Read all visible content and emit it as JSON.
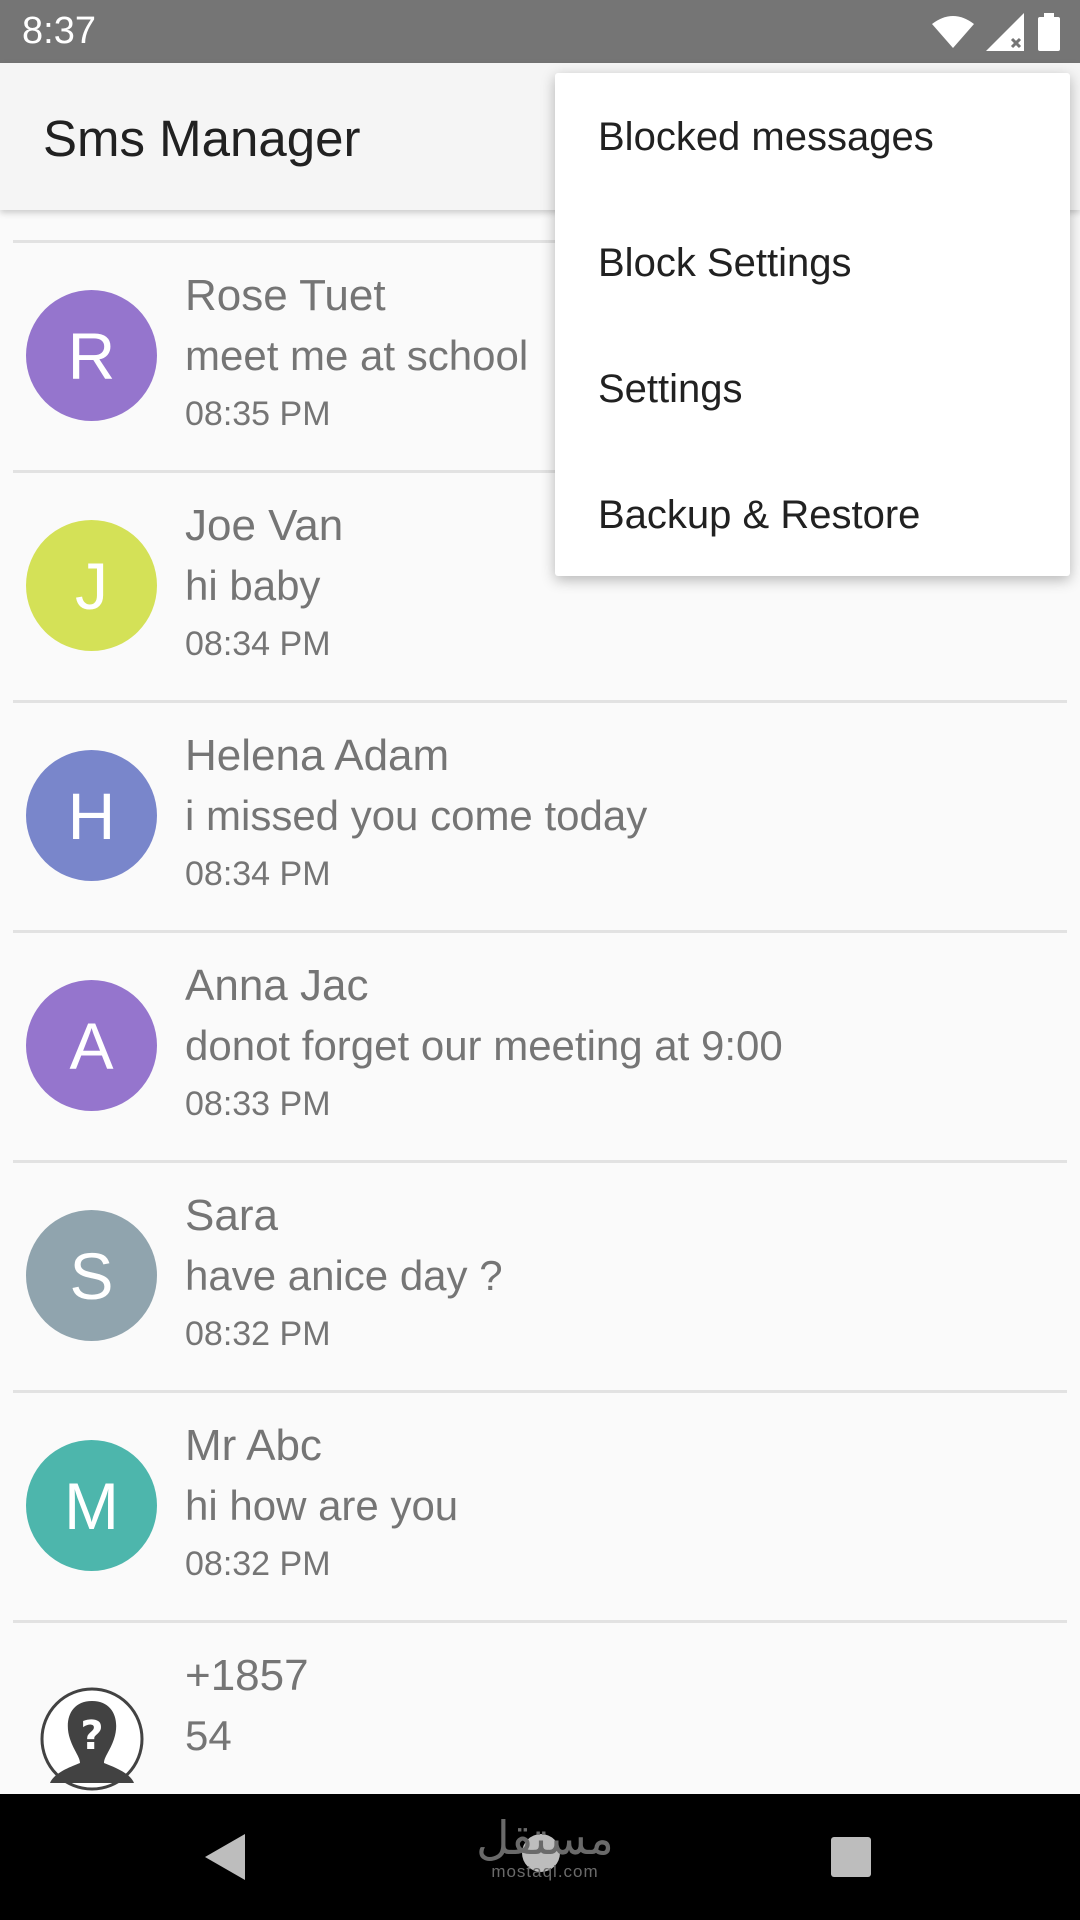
{
  "status_bar": {
    "time": "8:37",
    "icons": [
      "wifi-icon",
      "cell-signal-icon",
      "battery-icon"
    ]
  },
  "app_bar": {
    "title": "Sms Manager"
  },
  "conversations": [
    {
      "initial": "R",
      "name": "Rose Tuet",
      "message": "meet me at school",
      "time": "08:35 PM",
      "color": "#9575cd"
    },
    {
      "initial": "J",
      "name": "Joe Van",
      "message": "hi baby",
      "time": "08:34 PM",
      "color": "#d4e157"
    },
    {
      "initial": "H",
      "name": "Helena Adam",
      "message": "i missed you come today",
      "time": "08:34 PM",
      "color": "#7986cb"
    },
    {
      "initial": "A",
      "name": "Anna Jac",
      "message": "donot forget our meeting at 9:00",
      "time": "08:33 PM",
      "color": "#9575cd"
    },
    {
      "initial": "S",
      "name": "Sara",
      "message": "have anice day ?",
      "time": "08:32 PM",
      "color": "#90a4ae"
    },
    {
      "initial": "M",
      "name": "Mr Abc",
      "message": "hi how are you",
      "time": "08:32 PM",
      "color": "#4db6ac"
    },
    {
      "name": "+1857",
      "message": "54",
      "avatar_icon": "unknown-contact-icon"
    }
  ],
  "overflow_menu": {
    "items": [
      "Blocked messages",
      "Block Settings",
      "Settings",
      "Backup & Restore"
    ]
  },
  "nav_bar": {
    "icons": [
      "back-icon",
      "home-icon",
      "recents-icon"
    ]
  },
  "watermark": {
    "arabic": "مستقل",
    "latin": "mostaql.com"
  }
}
